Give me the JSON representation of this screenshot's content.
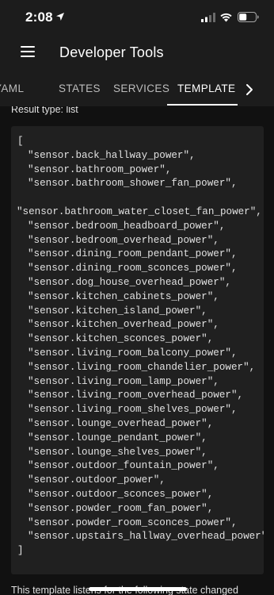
{
  "status_bar": {
    "time": "2:08"
  },
  "app_bar": {
    "title": "Developer Tools"
  },
  "tabs": [
    {
      "label": "YAML"
    },
    {
      "label": "STATES"
    },
    {
      "label": "SERVICES"
    },
    {
      "label": "TEMPLATE"
    }
  ],
  "active_tab": "TEMPLATE",
  "result": {
    "type_text": "Result type: list",
    "open_bracket": "[",
    "close_bracket": "]",
    "items": [
      "\"sensor.back_hallway_power\",",
      "\"sensor.bathroom_power\",",
      "\"sensor.bathroom_shower_fan_power\",",
      "\"sensor.bathroom_water_closet_fan_power\",",
      "\"sensor.bedroom_headboard_power\",",
      "\"sensor.bedroom_overhead_power\",",
      "\"sensor.dining_room_pendant_power\",",
      "\"sensor.dining_room_sconces_power\",",
      "\"sensor.dog_house_overhead_power\",",
      "\"sensor.kitchen_cabinets_power\",",
      "\"sensor.kitchen_island_power\",",
      "\"sensor.kitchen_overhead_power\",",
      "\"sensor.kitchen_sconces_power\",",
      "\"sensor.living_room_balcony_power\",",
      "\"sensor.living_room_chandelier_power\",",
      "\"sensor.living_room_lamp_power\",",
      "\"sensor.living_room_overhead_power\",",
      "\"sensor.living_room_shelves_power\",",
      "\"sensor.lounge_overhead_power\",",
      "\"sensor.lounge_pendant_power\",",
      "\"sensor.lounge_shelves_power\",",
      "\"sensor.outdoor_fountain_power\",",
      "\"sensor.outdoor_power\",",
      "\"sensor.outdoor_sconces_power\",",
      "\"sensor.powder_room_fan_power\",",
      "\"sensor.powder_room_sconces_power\",",
      "\"sensor.upstairs_hallway_overhead_power\""
    ]
  },
  "footer_text": "This template listens for the following state changed",
  "icons": {
    "status_location": "location-arrow-icon",
    "status_signal": "cellular-signal-icon",
    "status_wifi": "wifi-icon",
    "status_battery": "battery-icon",
    "menu": "hamburger-menu-icon",
    "tab_scroll": "chevron-right-icon"
  },
  "colors": {
    "app_bar": "#1c1c1c",
    "background": "#111111",
    "code_background": "#202020",
    "text": "#e1e1e1"
  }
}
